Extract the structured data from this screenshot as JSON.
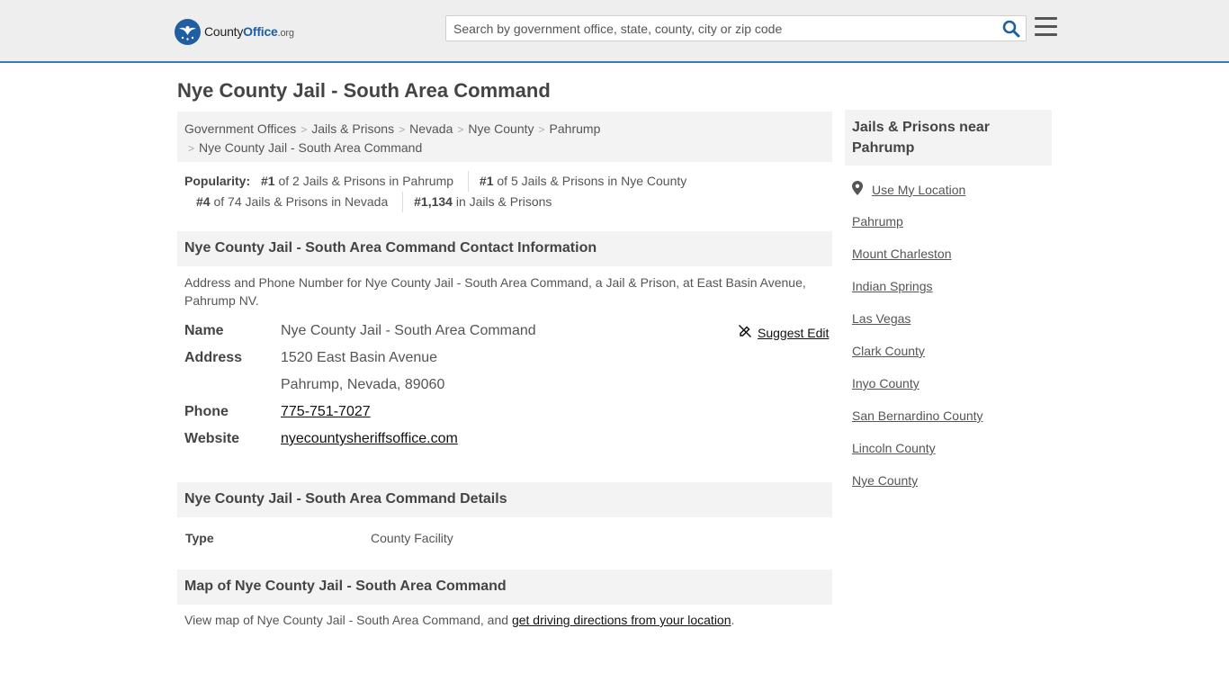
{
  "header": {
    "logo": {
      "part1": "County",
      "part2": "Office",
      "part3": ".org"
    },
    "search_placeholder": "Search by government office, state, county, city or zip code"
  },
  "page_title": "Nye County Jail - South Area Command",
  "breadcrumbs": [
    "Government Offices",
    "Jails & Prisons",
    "Nevada",
    "Nye County",
    "Pahrump",
    "Nye County Jail - South Area Command"
  ],
  "popularity": {
    "label": "Popularity:",
    "items": [
      {
        "rank": "#1",
        "text": "of 2 Jails & Prisons in Pahrump"
      },
      {
        "rank": "#1",
        "text": "of 5 Jails & Prisons in Nye County"
      },
      {
        "rank": "#4",
        "text": "of 74 Jails & Prisons in Nevada"
      },
      {
        "rank": "#1,134",
        "text": "in Jails & Prisons"
      }
    ]
  },
  "contact": {
    "heading": "Nye County Jail - South Area Command Contact Information",
    "description": "Address and Phone Number for Nye County Jail - South Area Command, a Jail & Prison, at East Basin Avenue, Pahrump NV.",
    "suggest_edit": "Suggest Edit",
    "fields": {
      "name_label": "Name",
      "name": "Nye County Jail - South Area Command",
      "address_label": "Address",
      "address_line1": "1520 East Basin Avenue",
      "address_line2": "Pahrump, Nevada, 89060",
      "phone_label": "Phone",
      "phone": "775-751-7027",
      "website_label": "Website",
      "website": "nyecountysheriffsoffice.com"
    }
  },
  "details": {
    "heading": "Nye County Jail - South Area Command Details",
    "type_label": "Type",
    "type_value": "County Facility"
  },
  "map": {
    "heading": "Map of Nye County Jail - South Area Command",
    "text_before": "View map of Nye County Jail - South Area Command, and ",
    "link": "get driving directions from your location",
    "text_after": "."
  },
  "sidebar": {
    "heading": "Jails & Prisons near Pahrump",
    "use_location": "Use My Location",
    "links": [
      "Pahrump",
      "Mount Charleston",
      "Indian Springs",
      "Las Vegas",
      "Clark County",
      "Inyo County",
      "San Bernardino County",
      "Lincoln County",
      "Nye County"
    ]
  },
  "colors": {
    "brand_blue": "#1f5ea0",
    "header_bg": "#eeeeee",
    "header_border": "#3c78b8",
    "panel_bg": "#f3f3f3"
  }
}
